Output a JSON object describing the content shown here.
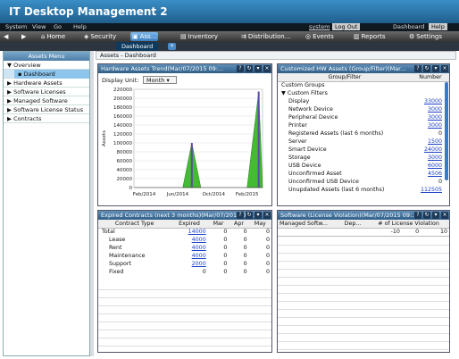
{
  "app_title": "IT Desktop Management 2",
  "menu": {
    "items": [
      "System",
      "View",
      "Go",
      "Help"
    ],
    "user": "system",
    "logout": "Log Out",
    "dashboard": "Dashboard",
    "help": "Help"
  },
  "toolbar": {
    "home": "Home",
    "security": "Security",
    "assets": "Ass...",
    "inventory": "Inventory",
    "distribution": "Distribution...",
    "events": "Events",
    "reports": "Reports",
    "settings": "Settings"
  },
  "tabs": {
    "dashboard": "Dashboard"
  },
  "sidebar": {
    "title": "Assets Menu",
    "items": [
      {
        "label": "Overview"
      },
      {
        "label": "Dashboard"
      },
      {
        "label": "Hardware Assets"
      },
      {
        "label": "Software Licenses"
      },
      {
        "label": "Managed Software"
      },
      {
        "label": "Software License Status"
      },
      {
        "label": "Contracts"
      }
    ]
  },
  "breadcrumb": "Assets - Dashboard",
  "trend": {
    "title": "Hardware Assets Trend(Mar/07/2015 09:...",
    "display_unit_label": "Display Unit:",
    "display_unit_value": "Month",
    "ylabel": "Assets"
  },
  "chart_data": {
    "type": "area",
    "title": "Hardware Assets Trend(Mar/07/2015 09:...",
    "ylabel": "Assets",
    "ylim": [
      0,
      220000
    ],
    "yticks": [
      0,
      20000,
      40000,
      60000,
      80000,
      100000,
      120000,
      140000,
      160000,
      180000,
      200000,
      220000
    ],
    "xtick_labels": [
      "Feb/2014",
      "Jun/2014",
      "Oct/2014",
      "Feb/2015"
    ],
    "series": [
      {
        "values": [
          [
            0.0,
            0
          ],
          [
            0.24,
            0
          ],
          [
            0.38,
            0
          ],
          [
            0.45,
            100000
          ],
          [
            0.52,
            0
          ],
          [
            0.88,
            0
          ],
          [
            0.97,
            215000
          ],
          [
            1.0,
            0
          ]
        ]
      }
    ]
  },
  "hw": {
    "title": "Customized HW Assets (Group/Filter)(Mar...",
    "col_group": "Group/Filter",
    "col_number": "Number",
    "rows": [
      {
        "label": "Custom Groups",
        "value": "",
        "link": false,
        "indent": 0
      },
      {
        "label": "▼ Custom Filters",
        "value": "",
        "link": false,
        "indent": 0
      },
      {
        "label": "Display",
        "value": "33000",
        "link": true,
        "indent": 1
      },
      {
        "label": "Network Device",
        "value": "3000",
        "link": true,
        "indent": 1
      },
      {
        "label": "Peripheral Device",
        "value": "3000",
        "link": true,
        "indent": 1
      },
      {
        "label": "Printer",
        "value": "3000",
        "link": true,
        "indent": 1
      },
      {
        "label": "Registered Assets (last 6 months)",
        "value": "0",
        "link": false,
        "indent": 1
      },
      {
        "label": "Server",
        "value": "1500",
        "link": true,
        "indent": 1
      },
      {
        "label": "Smart Device",
        "value": "24000",
        "link": true,
        "indent": 1
      },
      {
        "label": "Storage",
        "value": "3000",
        "link": true,
        "indent": 1
      },
      {
        "label": "USB Device",
        "value": "6000",
        "link": true,
        "indent": 1
      },
      {
        "label": "Unconfirmed Asset",
        "value": "4506",
        "link": true,
        "indent": 1
      },
      {
        "label": "Unconfirmed USB Device",
        "value": "0",
        "link": false,
        "indent": 1
      },
      {
        "label": "Unupdated Assets (last 6 months)",
        "value": "112505",
        "link": true,
        "indent": 1
      }
    ]
  },
  "contracts": {
    "title": "Expired Contracts (next 3 months)(Mar/07/2015 09:...",
    "headers": [
      "Contract Type",
      "Expired",
      "Mar",
      "Apr",
      "May"
    ],
    "rows": [
      {
        "type": "Total",
        "expired": "14000",
        "mar": "0",
        "apr": "0",
        "may": "0",
        "link": true,
        "indent": 0
      },
      {
        "type": "Lease",
        "expired": "4000",
        "mar": "0",
        "apr": "0",
        "may": "0",
        "link": true,
        "indent": 1
      },
      {
        "type": "Rent",
        "expired": "4000",
        "mar": "0",
        "apr": "0",
        "may": "0",
        "link": true,
        "indent": 1
      },
      {
        "type": "Maintenance",
        "expired": "4000",
        "mar": "0",
        "apr": "0",
        "may": "0",
        "link": true,
        "indent": 1
      },
      {
        "type": "Support",
        "expired": "2000",
        "mar": "0",
        "apr": "0",
        "may": "0",
        "link": true,
        "indent": 1
      },
      {
        "type": "Fixed",
        "expired": "0",
        "mar": "0",
        "apr": "0",
        "may": "0",
        "link": false,
        "indent": 1
      }
    ]
  },
  "violation": {
    "title": "Software (License Violation)(Mar/07/2015 09:...",
    "headers": [
      "Managed Softw...",
      "Dep...",
      "# of License Violation"
    ],
    "scale": [
      "-10",
      "0",
      "10"
    ]
  }
}
